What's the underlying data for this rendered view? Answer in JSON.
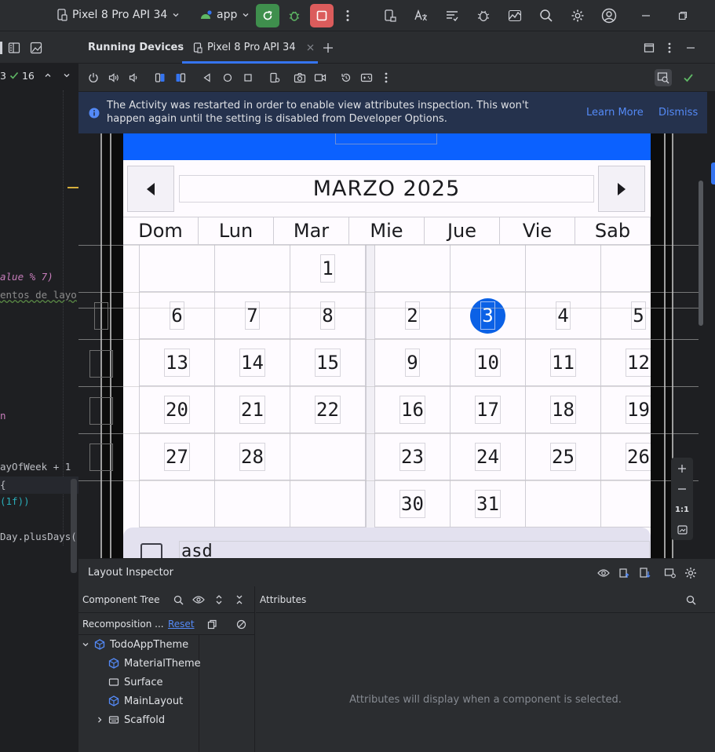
{
  "toolbar": {
    "device": "Pixel 8 Pro API 34",
    "module": "app"
  },
  "editor": {
    "badges": {
      "warnings": "3",
      "checks": "16"
    },
    "lines": [
      {
        "text": "alue % 7)"
      },
      {
        "text": "entos de layo"
      },
      {
        "text": "n"
      },
      {
        "text": "ayOfWeek + 1"
      },
      {
        "text": "{"
      },
      {
        "text": "(1f))"
      },
      {
        "text": "Day.plusDays("
      }
    ]
  },
  "running_devices": {
    "title": "Running Devices",
    "tab": "Pixel 8 Pro API 34"
  },
  "banner": {
    "message": "The Activity was restarted in order to enable view attributes inspection. This won't happen again until the setting is disabled from Developer Options.",
    "learn_more": "Learn More",
    "dismiss": "Dismiss"
  },
  "calendar": {
    "month": "MARZO 2025",
    "day_names": [
      "Dom",
      "Lun",
      "Mar",
      "Mie",
      "Jue",
      "Vie",
      "Sab"
    ],
    "left_weeks": [
      [
        "",
        "",
        "1"
      ],
      [
        "6",
        "7",
        "8"
      ],
      [
        "13",
        "14",
        "15"
      ],
      [
        "20",
        "21",
        "22"
      ],
      [
        "27",
        "28",
        ""
      ],
      [
        "",
        "",
        ""
      ]
    ],
    "right_weeks": [
      [
        "",
        "",
        "",
        ""
      ],
      [
        "2",
        "3",
        "4",
        "5"
      ],
      [
        "9",
        "10",
        "11",
        "12"
      ],
      [
        "16",
        "17",
        "18",
        "19"
      ],
      [
        "23",
        "24",
        "25",
        "26"
      ],
      [
        "30",
        "31",
        "",
        ""
      ]
    ],
    "selected_day": "3",
    "selected_color": "#0b61e6",
    "task_text": "asd"
  },
  "zoom": {
    "one_to_one": "1:1"
  },
  "layout_inspector": {
    "title": "Layout Inspector",
    "component_tree": "Component Tree",
    "attributes": "Attributes",
    "recomposition": "Recomposition ...",
    "reset": "Reset",
    "empty_message": "Attributes will display when a component is selected.",
    "tree": [
      {
        "label": "TodoAppTheme",
        "icon": "compose-icon"
      },
      {
        "label": "MaterialTheme",
        "icon": "compose-icon"
      },
      {
        "label": "Surface",
        "icon": "surface-icon"
      },
      {
        "label": "MainLayout",
        "icon": "compose-icon"
      },
      {
        "label": "Scaffold",
        "icon": "scaffold-icon"
      }
    ]
  },
  "colors": {
    "accent": "#3574f0",
    "run_green": "#3f8f4d",
    "stop_red": "#db5c5c",
    "link": "#548af7",
    "phone_blue": "#0b61ff"
  }
}
